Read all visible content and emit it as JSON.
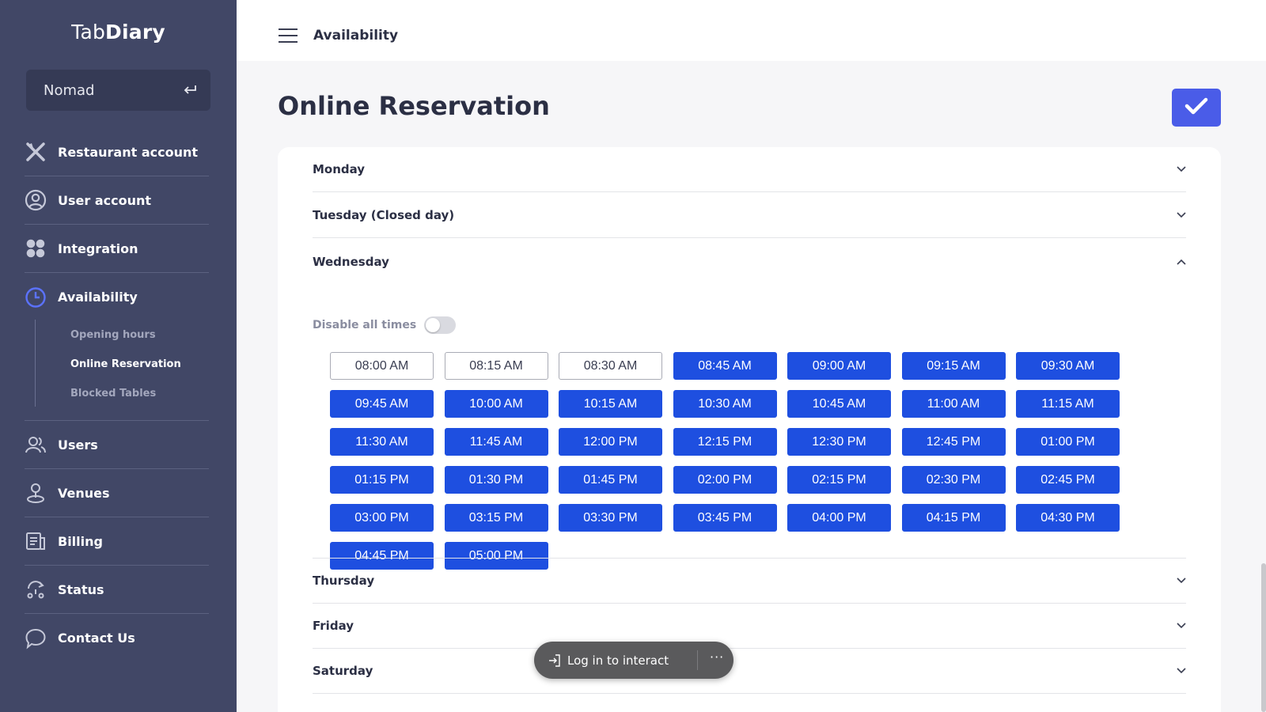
{
  "sidebar": {
    "logo_light": "Tab",
    "logo_bold": "Diary",
    "venue": {
      "name": "Nomad",
      "switch_icon": "return-arrow-icon"
    },
    "items": [
      {
        "label": "Restaurant account",
        "icon": "cutlery-icon"
      },
      {
        "label": "User account",
        "icon": "user-circle-icon"
      },
      {
        "label": "Integration",
        "icon": "grid-dots-icon"
      },
      {
        "label": "Availability",
        "icon": "clock-icon"
      },
      {
        "label": "Users",
        "icon": "users-icon"
      },
      {
        "label": "Venues",
        "icon": "location-pin-icon"
      },
      {
        "label": "Billing",
        "icon": "receipt-icon"
      },
      {
        "label": "Status",
        "icon": "status-icon"
      },
      {
        "label": "Contact Us",
        "icon": "chat-bubble-icon"
      }
    ],
    "availability_sub": [
      "Opening hours",
      "Online Reservation",
      "Blocked Tables"
    ],
    "active_sub": "Online Reservation"
  },
  "header": {
    "title": "Availability"
  },
  "main": {
    "page_title": "Online Reservation",
    "save_icon": "check-icon",
    "accent_color": "#1e4fe0",
    "days": {
      "monday": "Monday",
      "tuesday": "Tuesday (Closed day)",
      "wednesday": "Wednesday",
      "thursday": "Thursday",
      "friday": "Friday",
      "saturday": "Saturday"
    },
    "expanded_day": "Wednesday",
    "disable_all_label": "Disable all times",
    "disable_all_on": false,
    "slots": [
      {
        "time": "08:00 AM",
        "enabled": false
      },
      {
        "time": "08:15 AM",
        "enabled": false
      },
      {
        "time": "08:30 AM",
        "enabled": false
      },
      {
        "time": "08:45 AM",
        "enabled": true
      },
      {
        "time": "09:00 AM",
        "enabled": true
      },
      {
        "time": "09:15 AM",
        "enabled": true
      },
      {
        "time": "09:30 AM",
        "enabled": true
      },
      {
        "time": "09:45 AM",
        "enabled": true
      },
      {
        "time": "10:00 AM",
        "enabled": true
      },
      {
        "time": "10:15 AM",
        "enabled": true
      },
      {
        "time": "10:30 AM",
        "enabled": true
      },
      {
        "time": "10:45 AM",
        "enabled": true
      },
      {
        "time": "11:00 AM",
        "enabled": true
      },
      {
        "time": "11:15 AM",
        "enabled": true
      },
      {
        "time": "11:30 AM",
        "enabled": true
      },
      {
        "time": "11:45 AM",
        "enabled": true
      },
      {
        "time": "12:00 PM",
        "enabled": true
      },
      {
        "time": "12:15 PM",
        "enabled": true
      },
      {
        "time": "12:30 PM",
        "enabled": true
      },
      {
        "time": "12:45 PM",
        "enabled": true
      },
      {
        "time": "01:00 PM",
        "enabled": true
      },
      {
        "time": "01:15 PM",
        "enabled": true
      },
      {
        "time": "01:30 PM",
        "enabled": true
      },
      {
        "time": "01:45 PM",
        "enabled": true
      },
      {
        "time": "02:00 PM",
        "enabled": true
      },
      {
        "time": "02:15 PM",
        "enabled": true
      },
      {
        "time": "02:30 PM",
        "enabled": true
      },
      {
        "time": "02:45 PM",
        "enabled": true
      },
      {
        "time": "03:00 PM",
        "enabled": true
      },
      {
        "time": "03:15 PM",
        "enabled": true
      },
      {
        "time": "03:30 PM",
        "enabled": true
      },
      {
        "time": "03:45 PM",
        "enabled": true
      },
      {
        "time": "04:00 PM",
        "enabled": true
      },
      {
        "time": "04:15 PM",
        "enabled": true
      },
      {
        "time": "04:30 PM",
        "enabled": true
      },
      {
        "time": "04:45 PM",
        "enabled": true
      },
      {
        "time": "05:00 PM",
        "enabled": true
      }
    ]
  },
  "overlay": {
    "login_label": "Log in to interact",
    "more_label": "···"
  }
}
